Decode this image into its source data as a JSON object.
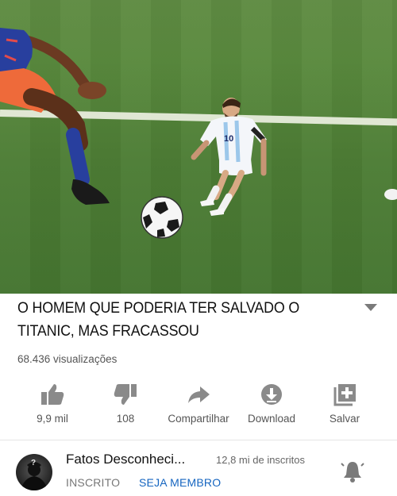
{
  "video": {
    "title": "O HOMEM QUE PODERIA TER SALVADO O TITANIC, MAS FRACASSOU",
    "views": "68.436 visualizações",
    "player_number": "10"
  },
  "actions": {
    "like": {
      "label": "9,9 mil",
      "icon": "thumbs-up-icon"
    },
    "dislike": {
      "label": "108",
      "icon": "thumbs-down-icon"
    },
    "share": {
      "label": "Compartilhar",
      "icon": "share-arrow-icon"
    },
    "download": {
      "label": "Download",
      "icon": "download-icon"
    },
    "save": {
      "label": "Salvar",
      "icon": "add-to-playlist-icon"
    }
  },
  "channel": {
    "name": "Fatos Desconheci...",
    "subscribers": "12,8 mi de inscritos",
    "subscribed_label": "INSCRITO",
    "member_label": "SEJA MEMBRO"
  },
  "colors": {
    "grass": "#5a8a3e",
    "icon_gray": "#8a8a8a",
    "link_blue": "#1565c0",
    "argentina_blue": "#79b6e6",
    "colombia_blue": "#283f9e",
    "colombia_orange": "#ee6a3a"
  }
}
